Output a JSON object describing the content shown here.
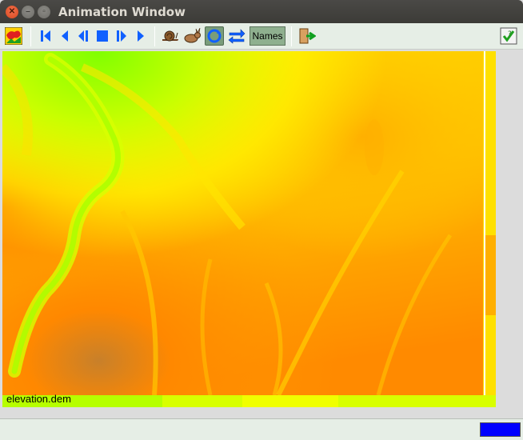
{
  "window": {
    "title": "Animation Window"
  },
  "toolbar": {
    "names_label": "Names",
    "icons": [
      "map-display-icon",
      "rewind-to-start-icon",
      "play-backward-icon",
      "step-backward-icon",
      "stop-icon",
      "step-forward-icon",
      "play-forward-icon",
      "slower-snail-icon",
      "faster-rabbit-icon",
      "loop-icon",
      "swing-icon",
      "exit-icon",
      "help-icon"
    ]
  },
  "map": {
    "layer_name": "elevation.dem",
    "colors": {
      "low": "#ff8c00",
      "mid": "#ffd400",
      "high": "#ffff00",
      "peak": "#80ff00"
    }
  },
  "status": {
    "progress": 1.0,
    "progress_color": "#0000ff"
  }
}
